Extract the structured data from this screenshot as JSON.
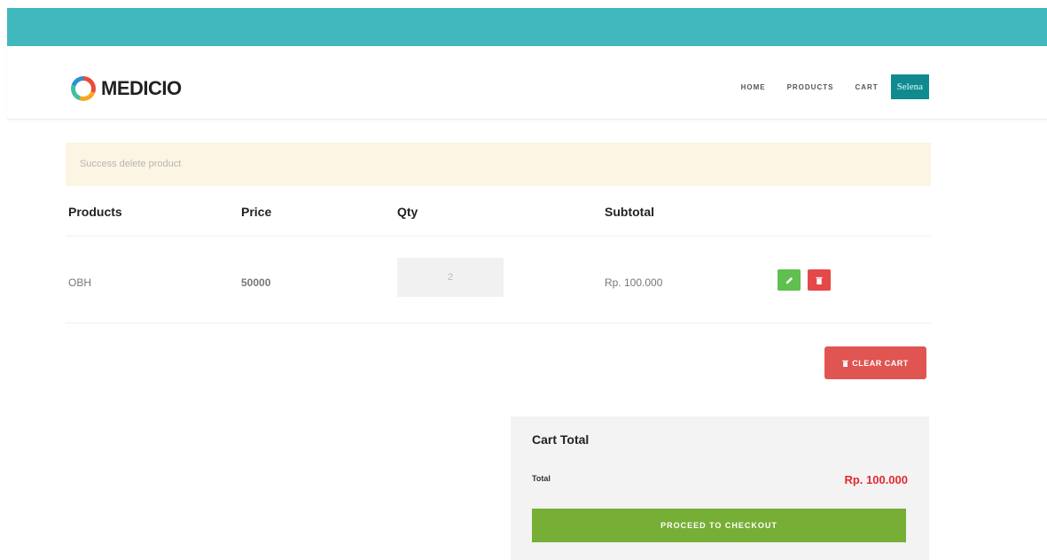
{
  "brand": {
    "name": "MEDICIO",
    "logo_icon": "ring-logo-icon"
  },
  "nav": {
    "items": [
      "HOME",
      "PRODUCTS",
      "CART"
    ],
    "user": "Selena"
  },
  "alert": {
    "message": "Success delete product"
  },
  "table": {
    "headers": [
      "Products",
      "Price",
      "Qty",
      "Subtotal"
    ],
    "rows": [
      {
        "product": "OBH",
        "price": "50000",
        "qty": "2",
        "subtotal": "Rp. 100.000"
      }
    ]
  },
  "actions": {
    "edit_icon": "edit-icon",
    "delete_icon": "trash-icon",
    "clear_cart": "CLEAR CART"
  },
  "cart_total": {
    "title": "Cart Total",
    "total_label": "Total",
    "total_value": "Rp. 100.000",
    "checkout": "PROCEED TO CHECKOUT"
  },
  "colors": {
    "top_bar": "#40b8bd",
    "user_button": "#0f8a8f",
    "alert_bg": "#fcf5e3",
    "edit_button": "#5fbf4f",
    "delete_button": "#e54848",
    "clear_cart": "#e05452",
    "total_value": "#e3292f",
    "checkout": "#77ae35"
  }
}
